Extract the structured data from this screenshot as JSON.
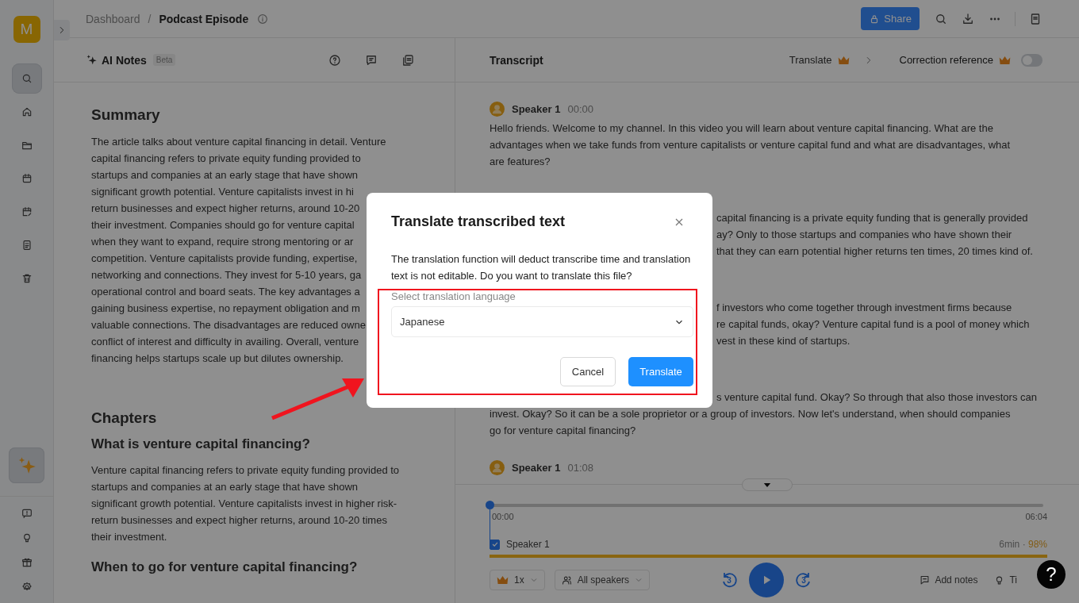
{
  "sidebar": {
    "avatar": "M",
    "nav": [
      {
        "kind": "search",
        "selected": true
      },
      {
        "kind": "home",
        "selected": false
      },
      {
        "kind": "folder",
        "selected": false
      },
      {
        "kind": "calendar",
        "selected": false
      },
      {
        "kind": "calendar-edit",
        "selected": false
      },
      {
        "kind": "document",
        "selected": false
      },
      {
        "kind": "trash",
        "selected": false
      }
    ],
    "assistant": {
      "kind": "sparkle",
      "selected": true
    },
    "footer": [
      {
        "kind": "feedback"
      },
      {
        "kind": "lightbulb"
      },
      {
        "kind": "gift"
      },
      {
        "kind": "settings"
      }
    ]
  },
  "breadcrumb": {
    "items": [
      "Dashboard",
      "Podcast Episode"
    ],
    "separator": "/"
  },
  "toolbar": {
    "share": "Share"
  },
  "notes": {
    "title": "AI Notes",
    "badge": "Beta",
    "summary_heading": "Summary",
    "summary_lines": [
      "The article talks about venture capital financing in detail. Venture",
      "capital financing refers to private equity funding provided to",
      "startups and companies at an early stage that have shown",
      "significant growth potential. Venture capitalists invest in hi",
      "return businesses and expect higher returns, around 10-20",
      "their investment. Companies should go for venture capital",
      "when they want to expand, require strong mentoring or ar",
      "competition. Venture capitalists provide funding, expertise,",
      "networking and connections. They invest for 5-10 years, ga",
      "operational control and board seats. The key advantages a",
      "gaining business expertise, no repayment obligation and m",
      "valuable connections. The disadvantages are reduced owne",
      "conflict of interest and difficulty in availing. Overall, venture",
      "financing helps startups scale up but dilutes ownership."
    ],
    "chapters_heading": "Chapters",
    "chapters": [
      {
        "title": "What is venture capital financing?",
        "text": "Venture capital financing refers to private equity funding provided to startups and companies at an early stage that have shown significant growth potential. Venture capitalists invest in higher risk-return businesses and expect higher returns, around 10-20 times their investment."
      },
      {
        "title": "When to go for venture capital financing?"
      }
    ]
  },
  "transcript": {
    "title": "Transcript",
    "translate": "Translate",
    "correction": {
      "label": "Correction reference",
      "on": false
    },
    "segments": [
      {
        "kind": "full",
        "speaker": "Speaker 1",
        "time": "00:00",
        "text": "Hello friends. Welcome to my channel. In this video you will learn about venture capital financing. What are the advantages when we take funds from venture capitalists or venture capital fund and what are disadvantages, what are features?"
      },
      {
        "kind": "covered",
        "lines": [
          "capital financing is a private equity funding that is generally provided",
          "ay? Only to those startups and companies who have shown their",
          "that they can earn potential higher returns ten times, 20 times kind of."
        ]
      },
      {
        "kind": "covered",
        "lines": [
          "f investors who come together through investment firms because",
          "re capital funds, okay? Venture capital fund is a pool of money which",
          "vest in these kind of startups."
        ]
      },
      {
        "kind": "covered",
        "lines": [
          "s venture capital fund. Okay? So through that also those investors can"
        ],
        "text": "invest. Okay? So it can be a sole proprietor or a group of investors. Now let's understand, when should companies go for venture capital financing?"
      },
      {
        "kind": "header",
        "speaker": "Speaker 1",
        "time": "01:08"
      }
    ]
  },
  "player": {
    "level": 0,
    "start": "00:00",
    "end": "06:04",
    "speaker": {
      "name": "Speaker 1",
      "checked": true,
      "duration": "6min",
      "separator": "·",
      "share": "98%"
    },
    "speed": "1x",
    "speakers": "All speakers",
    "skip_back": "3",
    "skip_forward": "3",
    "add_notes": "Add notes",
    "tips": "Ti"
  },
  "help": "?",
  "dialog": {
    "title": "Translate transcribed text",
    "message": "The translation function will deduct transcribe time and translation text is not editable. Do you want to translate this file?",
    "field_label": "Select translation language",
    "value": "Japanese",
    "buttons": [
      {
        "kind": "secondary",
        "label": "Cancel"
      },
      {
        "kind": "primary",
        "label": "Translate"
      }
    ]
  }
}
